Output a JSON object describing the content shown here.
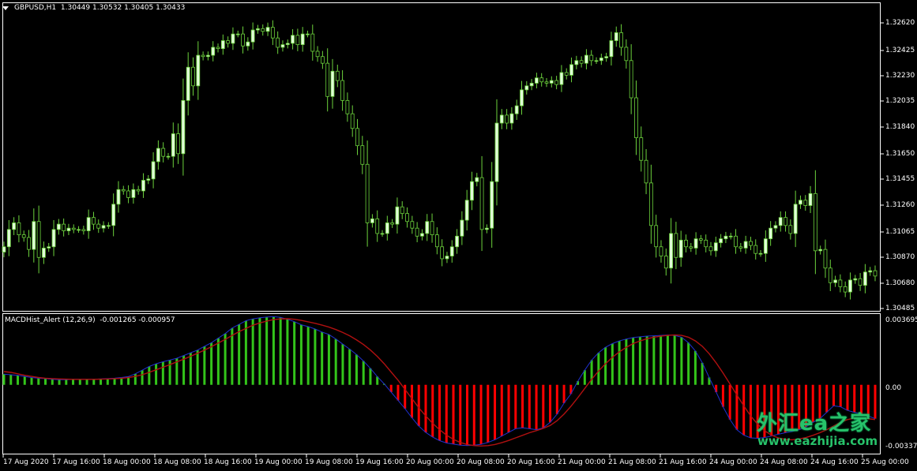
{
  "window": {
    "symbol_label": "GBPUSD,H1",
    "ohlc_label": "1.30449 1.30532 1.30405 1.30433"
  },
  "colors": {
    "background": "#000000",
    "bull_candle": "#e0ffd8",
    "candle_wick": "#6cd23c",
    "macd_positive": "#33c41a",
    "macd_negative": "#ff0000",
    "signal_line": "#b01010",
    "macd_outline": "#2030d0",
    "axis_text": "#ffffff",
    "watermark": "#27c26a"
  },
  "price_axis": {
    "labels": [
      "1.32620",
      "1.32425",
      "1.32230",
      "1.32035",
      "1.31840",
      "1.31650",
      "1.31455",
      "1.31260",
      "1.31065",
      "1.30870",
      "1.30680",
      "1.30485"
    ]
  },
  "macd_panel": {
    "title": "MACDHist_Alert (12,26,9)",
    "values_label": "-0.001265 -0.000957",
    "axis_labels": [
      "0.003695",
      "0.00",
      "-0.003372"
    ]
  },
  "time_axis": {
    "labels": [
      "17 Aug 2020",
      "17 Aug 16:00",
      "18 Aug 00:00",
      "18 Aug 08:00",
      "18 Aug 16:00",
      "19 Aug 00:00",
      "19 Aug 08:00",
      "19 Aug 16:00",
      "20 Aug 00:00",
      "20 Aug 08:00",
      "20 Aug 16:00",
      "21 Aug 00:00",
      "21 Aug 08:00",
      "21 Aug 16:00",
      "24 Aug 00:00",
      "24 Aug 08:00",
      "24 Aug 16:00",
      "25 Aug 00:00"
    ]
  },
  "watermark": {
    "chinese": "外汇ea之家",
    "url": "www.eazhijia.com"
  },
  "chart_data": [
    {
      "type": "candlestick",
      "title": "GBPUSD,H1",
      "ylim": [
        1.3043,
        1.3272
      ],
      "close": [
        1.309,
        1.3103,
        1.3108,
        1.3099,
        1.3097,
        1.3088,
        1.3109,
        1.3082,
        1.3089,
        1.309,
        1.3103,
        1.3107,
        1.3102,
        1.3104,
        1.3103,
        1.3103,
        1.3102,
        1.3112,
        1.3107,
        1.3104,
        1.3106,
        1.3106,
        1.3122,
        1.3133,
        1.3132,
        1.3127,
        1.3133,
        1.3132,
        1.314,
        1.3141,
        1.3154,
        1.3164,
        1.3158,
        1.3158,
        1.3175,
        1.316,
        1.32,
        1.3225,
        1.3211,
        1.3234,
        1.3233,
        1.3234,
        1.324,
        1.3239,
        1.3245,
        1.3243,
        1.325,
        1.325,
        1.3241,
        1.3244,
        1.3253,
        1.3254,
        1.3252,
        1.3255,
        1.3247,
        1.324,
        1.3242,
        1.3243,
        1.3249,
        1.3242,
        1.325,
        1.325,
        1.3237,
        1.3233,
        1.3228,
        1.3203,
        1.3222,
        1.3215,
        1.32,
        1.319,
        1.3179,
        1.3166,
        1.3152,
        1.3108,
        1.3111,
        1.31,
        1.31,
        1.3108,
        1.3107,
        1.312,
        1.3115,
        1.3109,
        1.3104,
        1.3098,
        1.31,
        1.3109,
        1.3099,
        1.309,
        1.3081,
        1.3083,
        1.309,
        1.3098,
        1.311,
        1.3125,
        1.3139,
        1.3142,
        1.3103,
        1.3104,
        1.3139,
        1.3183,
        1.3189,
        1.3183,
        1.319,
        1.3196,
        1.3208,
        1.3211,
        1.3213,
        1.3217,
        1.3214,
        1.3213,
        1.3215,
        1.3212,
        1.3221,
        1.3219,
        1.3227,
        1.323,
        1.3228,
        1.3234,
        1.323,
        1.323,
        1.3232,
        1.3233,
        1.3245,
        1.3251,
        1.324,
        1.323,
        1.3202,
        1.3172,
        1.3155,
        1.3138,
        1.3106,
        1.309,
        1.3083,
        1.3074,
        1.31,
        1.3082,
        1.3095,
        1.309,
        1.3089,
        1.3096,
        1.3095,
        1.309,
        1.3087,
        1.3093,
        1.3096,
        1.3098,
        1.3098,
        1.309,
        1.3089,
        1.3094,
        1.3091,
        1.3085,
        1.3085,
        1.3096,
        1.3104,
        1.3106,
        1.3112,
        1.3106,
        1.31,
        1.3122,
        1.3125,
        1.3121,
        1.313,
        1.3087,
        1.3088,
        1.3074,
        1.3063,
        1.3065,
        1.306,
        1.3056,
        1.3065,
        1.3066,
        1.3061,
        1.3071,
        1.3072,
        1.3068
      ]
    },
    {
      "type": "bar",
      "title": "MACDHist_Alert (12,26,9)",
      "ylim": [
        -0.003372,
        0.003695
      ],
      "series": [
        {
          "name": "MACDHist_Alert",
          "values": [
            0.00058,
            0.00055,
            0.00052,
            0.00046,
            0.0004,
            0.00036,
            0.00034,
            0.0003,
            0.00028,
            0.00028,
            0.0003,
            0.0003,
            0.0003,
            0.0003,
            0.00032,
            0.00034,
            0.00036,
            0.0004,
            0.00045,
            0.0006,
            0.0008,
            0.001,
            0.00115,
            0.00126,
            0.00135,
            0.00145,
            0.0016,
            0.00175,
            0.0019,
            0.0021,
            0.0023,
            0.00255,
            0.0028,
            0.0031,
            0.0033,
            0.0035,
            0.0036,
            0.00366,
            0.0037,
            0.00372,
            0.00368,
            0.00358,
            0.00345,
            0.00328,
            0.00318,
            0.00305,
            0.00288,
            0.00275,
            0.0025,
            0.00222,
            0.00195,
            0.00165,
            0.0013,
            0.0009,
            0.00045,
            5e-05,
            -0.0004,
            -0.00085,
            -0.0013,
            -0.0018,
            -0.00225,
            -0.0026,
            -0.00285,
            -0.00305,
            -0.00318,
            -0.00324,
            -0.0033,
            -0.00332,
            -0.0033,
            -0.00325,
            -0.00315,
            -0.003,
            -0.0028,
            -0.0026,
            -0.0024,
            -0.00235,
            -0.0024,
            -0.00245,
            -0.00235,
            -0.00205,
            -0.0016,
            -0.001,
            -0.0005,
            0.0002,
            0.0008,
            0.00135,
            0.00175,
            0.00205,
            0.00225,
            0.0024,
            0.0025,
            0.00258,
            0.00262,
            0.00266,
            0.00268,
            0.0027,
            0.00272,
            0.0027,
            0.0026,
            0.0023,
            0.00185,
            0.0012,
            0.0004,
            -0.0004,
            -0.0012,
            -0.0019,
            -0.00245,
            -0.00275,
            -0.0029,
            -0.00292,
            -0.00288,
            -0.0028,
            -0.0027,
            -0.00262,
            -0.00255,
            -0.00245,
            -0.0023,
            -0.00205,
            -0.00185,
            -0.0015,
            -0.00115,
            -0.0012,
            -0.0014,
            -0.0015,
            -0.0016,
            -0.0017,
            -0.00185
          ]
        },
        {
          "name": "Signal",
          "values": [
            0.00072,
            0.00068,
            0.0006,
            0.00052,
            0.00046,
            0.0004,
            0.00036,
            0.00034,
            0.00032,
            0.00031,
            0.0003,
            0.0003,
            0.0003,
            0.0003,
            0.00031,
            0.00032,
            0.00034,
            0.00036,
            0.0004,
            0.00046,
            0.00055,
            0.00068,
            0.00082,
            0.00096,
            0.0011,
            0.00125,
            0.0014,
            0.00156,
            0.00172,
            0.0019,
            0.00208,
            0.00228,
            0.00248,
            0.0027,
            0.0029,
            0.00308,
            0.00325,
            0.00338,
            0.00348,
            0.00356,
            0.0036,
            0.00361,
            0.00358,
            0.00352,
            0.00344,
            0.00336,
            0.00326,
            0.00315,
            0.00302,
            0.00286,
            0.00268,
            0.00245,
            0.0022,
            0.0019,
            0.00155,
            0.00115,
            0.0007,
            0.00025,
            -0.00025,
            -0.00075,
            -0.00125,
            -0.0017,
            -0.0021,
            -0.00245,
            -0.00275,
            -0.00298,
            -0.00315,
            -0.00326,
            -0.00332,
            -0.00334,
            -0.00332,
            -0.00326,
            -0.00316,
            -0.00304,
            -0.0029,
            -0.00276,
            -0.00262,
            -0.0025,
            -0.00238,
            -0.00222,
            -0.00196,
            -0.0016,
            -0.00118,
            -0.0007,
            -0.0002,
            0.0003,
            0.00075,
            0.00115,
            0.0015,
            0.0018,
            0.00205,
            0.00225,
            0.0024,
            0.00252,
            0.0026,
            0.00266,
            0.0027,
            0.00272,
            0.0027,
            0.0026,
            0.0024,
            0.0021,
            0.0017,
            0.0012,
            0.00065,
            5e-05,
            -0.00055,
            -0.00115,
            -0.0017,
            -0.00215,
            -0.0025,
            -0.00275,
            -0.0029,
            -0.00298,
            -0.003,
            -0.00296,
            -0.00288,
            -0.00276,
            -0.00262,
            -0.00245,
            -0.00225,
            -0.00205,
            -0.0019,
            -0.00182,
            -0.00182,
            -0.00185,
            -0.0019
          ]
        }
      ]
    }
  ]
}
